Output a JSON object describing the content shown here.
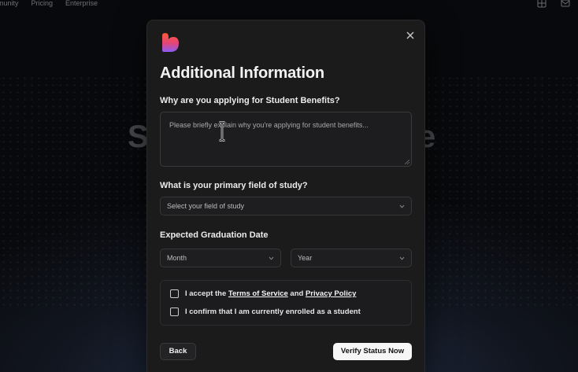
{
  "background": {
    "nav_items": [
      "munity",
      "Pricing",
      "Enterprise"
    ],
    "hero_left": "S",
    "hero_right": "e",
    "icons": [
      "grid-icon",
      "mail-icon"
    ]
  },
  "modal": {
    "logo": "heart-logo-icon",
    "close_icon": "close-icon",
    "title": "Additional Information",
    "reason": {
      "label": "Why are you applying for Student Benefits?",
      "placeholder": "Please briefly explain why you're applying for student benefits..."
    },
    "field_of_study": {
      "label": "What is your primary field of study?",
      "placeholder": "Select your field of study"
    },
    "graduation": {
      "label": "Expected Graduation Date",
      "month_placeholder": "Month",
      "year_placeholder": "Year"
    },
    "consent": {
      "terms_prefix": "I accept the ",
      "terms_link": "Terms of Service",
      "terms_and": " and ",
      "privacy_link": "Privacy Policy",
      "enrolled": "I confirm that I am currently enrolled as a student"
    },
    "buttons": {
      "back": "Back",
      "verify": "Verify Status Now"
    }
  },
  "colors": {
    "modal_bg": "#1b1b1c",
    "primary_button": "#f6f6f7",
    "logo_gradient_top": "#ff5a36",
    "logo_gradient_bottom": "#8b5cf6"
  }
}
